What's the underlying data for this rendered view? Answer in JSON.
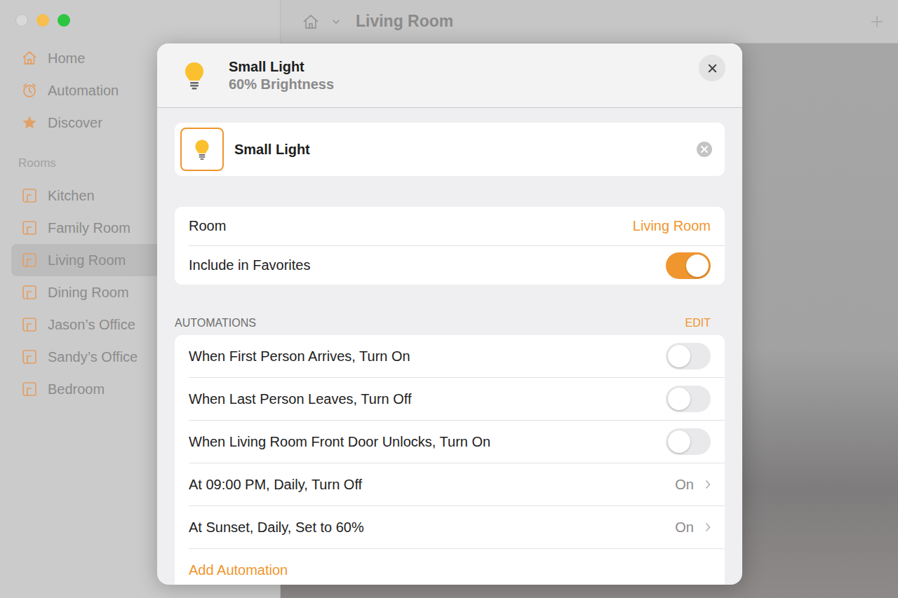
{
  "window": {
    "title": "Living Room"
  },
  "sidebar": {
    "items": [
      {
        "label": "Home",
        "icon": "home",
        "selected": false
      },
      {
        "label": "Automation",
        "icon": "clock",
        "selected": false
      },
      {
        "label": "Discover",
        "icon": "star",
        "selected": false
      }
    ],
    "rooms_header": "Rooms",
    "rooms": [
      {
        "label": "Kitchen",
        "selected": false
      },
      {
        "label": "Family Room",
        "selected": false
      },
      {
        "label": "Living Room",
        "selected": true
      },
      {
        "label": "Dining Room",
        "selected": false
      },
      {
        "label": "Jason’s Office",
        "selected": false
      },
      {
        "label": "Sandy’s Office",
        "selected": false
      },
      {
        "label": "Bedroom",
        "selected": false
      }
    ]
  },
  "dialog": {
    "name": "Small Light",
    "status": "60% Brightness",
    "name_field": {
      "value": "Small Light"
    },
    "settings": [
      {
        "label": "Room",
        "kind": "value",
        "value": "Living Room"
      },
      {
        "label": "Include in Favorites",
        "kind": "toggle",
        "on": true
      }
    ],
    "automations": {
      "header": "AUTOMATIONS",
      "edit": "EDIT",
      "items": [
        {
          "label": "When First Person Arrives, Turn On",
          "kind": "toggle",
          "on": false
        },
        {
          "label": "When Last Person Leaves, Turn Off",
          "kind": "toggle",
          "on": false
        },
        {
          "label": "When Living Room Front Door Unlocks, Turn On",
          "kind": "toggle",
          "on": false
        },
        {
          "label": "At 09:00 PM, Daily, Turn Off",
          "kind": "link",
          "status": "On"
        },
        {
          "label": "At Sunset, Daily, Set to 60%",
          "kind": "link",
          "status": "On"
        }
      ],
      "add": "Add Automation"
    }
  }
}
